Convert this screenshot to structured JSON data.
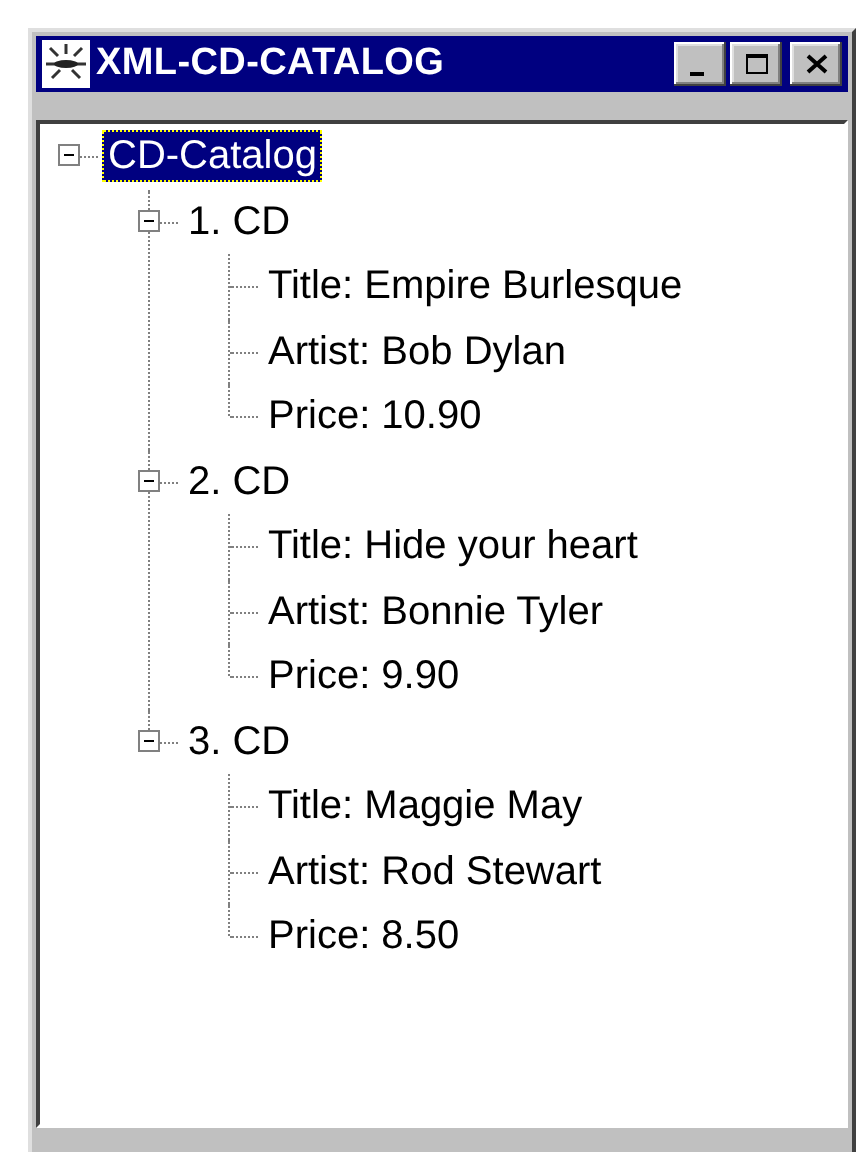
{
  "window": {
    "title": "XML-CD-CATALOG",
    "buttons": [
      {
        "kind": "minimize"
      },
      {
        "kind": "maximize"
      },
      {
        "kind": "close"
      }
    ]
  },
  "tree": [
    {
      "label": "CD-Catalog",
      "expanded": true,
      "selected": true,
      "children": [
        {
          "label": "1. CD",
          "expanded": true,
          "selected": false,
          "children": [
            {
              "label": "Title: Empire Burlesque",
              "selected": false
            },
            {
              "label": "Artist: Bob Dylan",
              "selected": false
            },
            {
              "label": "Price: 10.90",
              "selected": false
            }
          ]
        },
        {
          "label": "2. CD",
          "expanded": true,
          "selected": false,
          "children": [
            {
              "label": "Title: Hide your heart",
              "selected": false
            },
            {
              "label": "Artist: Bonnie Tyler",
              "selected": false
            },
            {
              "label": "Price: 9.90",
              "selected": false
            }
          ]
        },
        {
          "label": "3. CD",
          "expanded": true,
          "selected": false,
          "children": [
            {
              "label": "Title: Maggie May",
              "selected": false
            },
            {
              "label": "Artist: Rod Stewart",
              "selected": false
            },
            {
              "label": "Price: 8.50",
              "selected": false
            }
          ]
        }
      ]
    }
  ]
}
